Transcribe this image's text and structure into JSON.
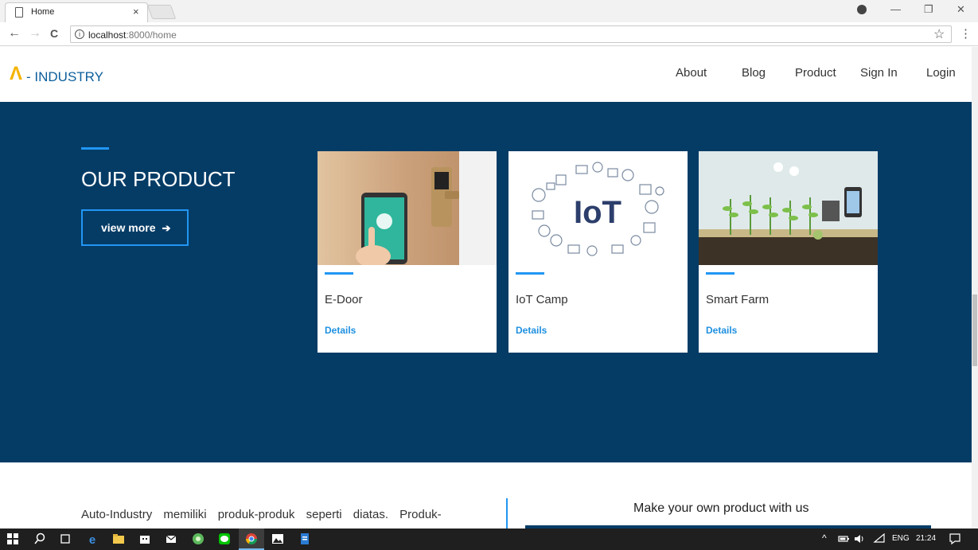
{
  "browser": {
    "tab_title": "Home",
    "tab_close": "×",
    "url_host": "localhost",
    "url_path": ":8000/home",
    "info": "i",
    "back": "←",
    "forward": "→",
    "reload": "C",
    "star": "☆",
    "menu": "⋮",
    "minimize": "—",
    "restore": "❐",
    "close": "✕"
  },
  "site": {
    "logo_mark": "Λ",
    "logo_text": "- INDUSTRY",
    "nav": [
      "About",
      "Blog",
      "Product",
      "Sign In",
      "Login"
    ]
  },
  "hero": {
    "title": "OUR PRODUCT",
    "view_more": "view more",
    "products": [
      {
        "title": "E-Door",
        "link": "Details",
        "image": "smart-door-lock-image"
      },
      {
        "title": "IoT Camp",
        "link": "Details",
        "image": "iot-icons-image"
      },
      {
        "title": "Smart Farm",
        "link": "Details",
        "image": "smart-farm-image"
      }
    ]
  },
  "about": {
    "text": "Auto-Industry memiliki produk-produk seperti diatas. Produk-",
    "cta": "Make your own product with us"
  },
  "taskbar": {
    "lang": "ENG",
    "time": "21:24"
  }
}
